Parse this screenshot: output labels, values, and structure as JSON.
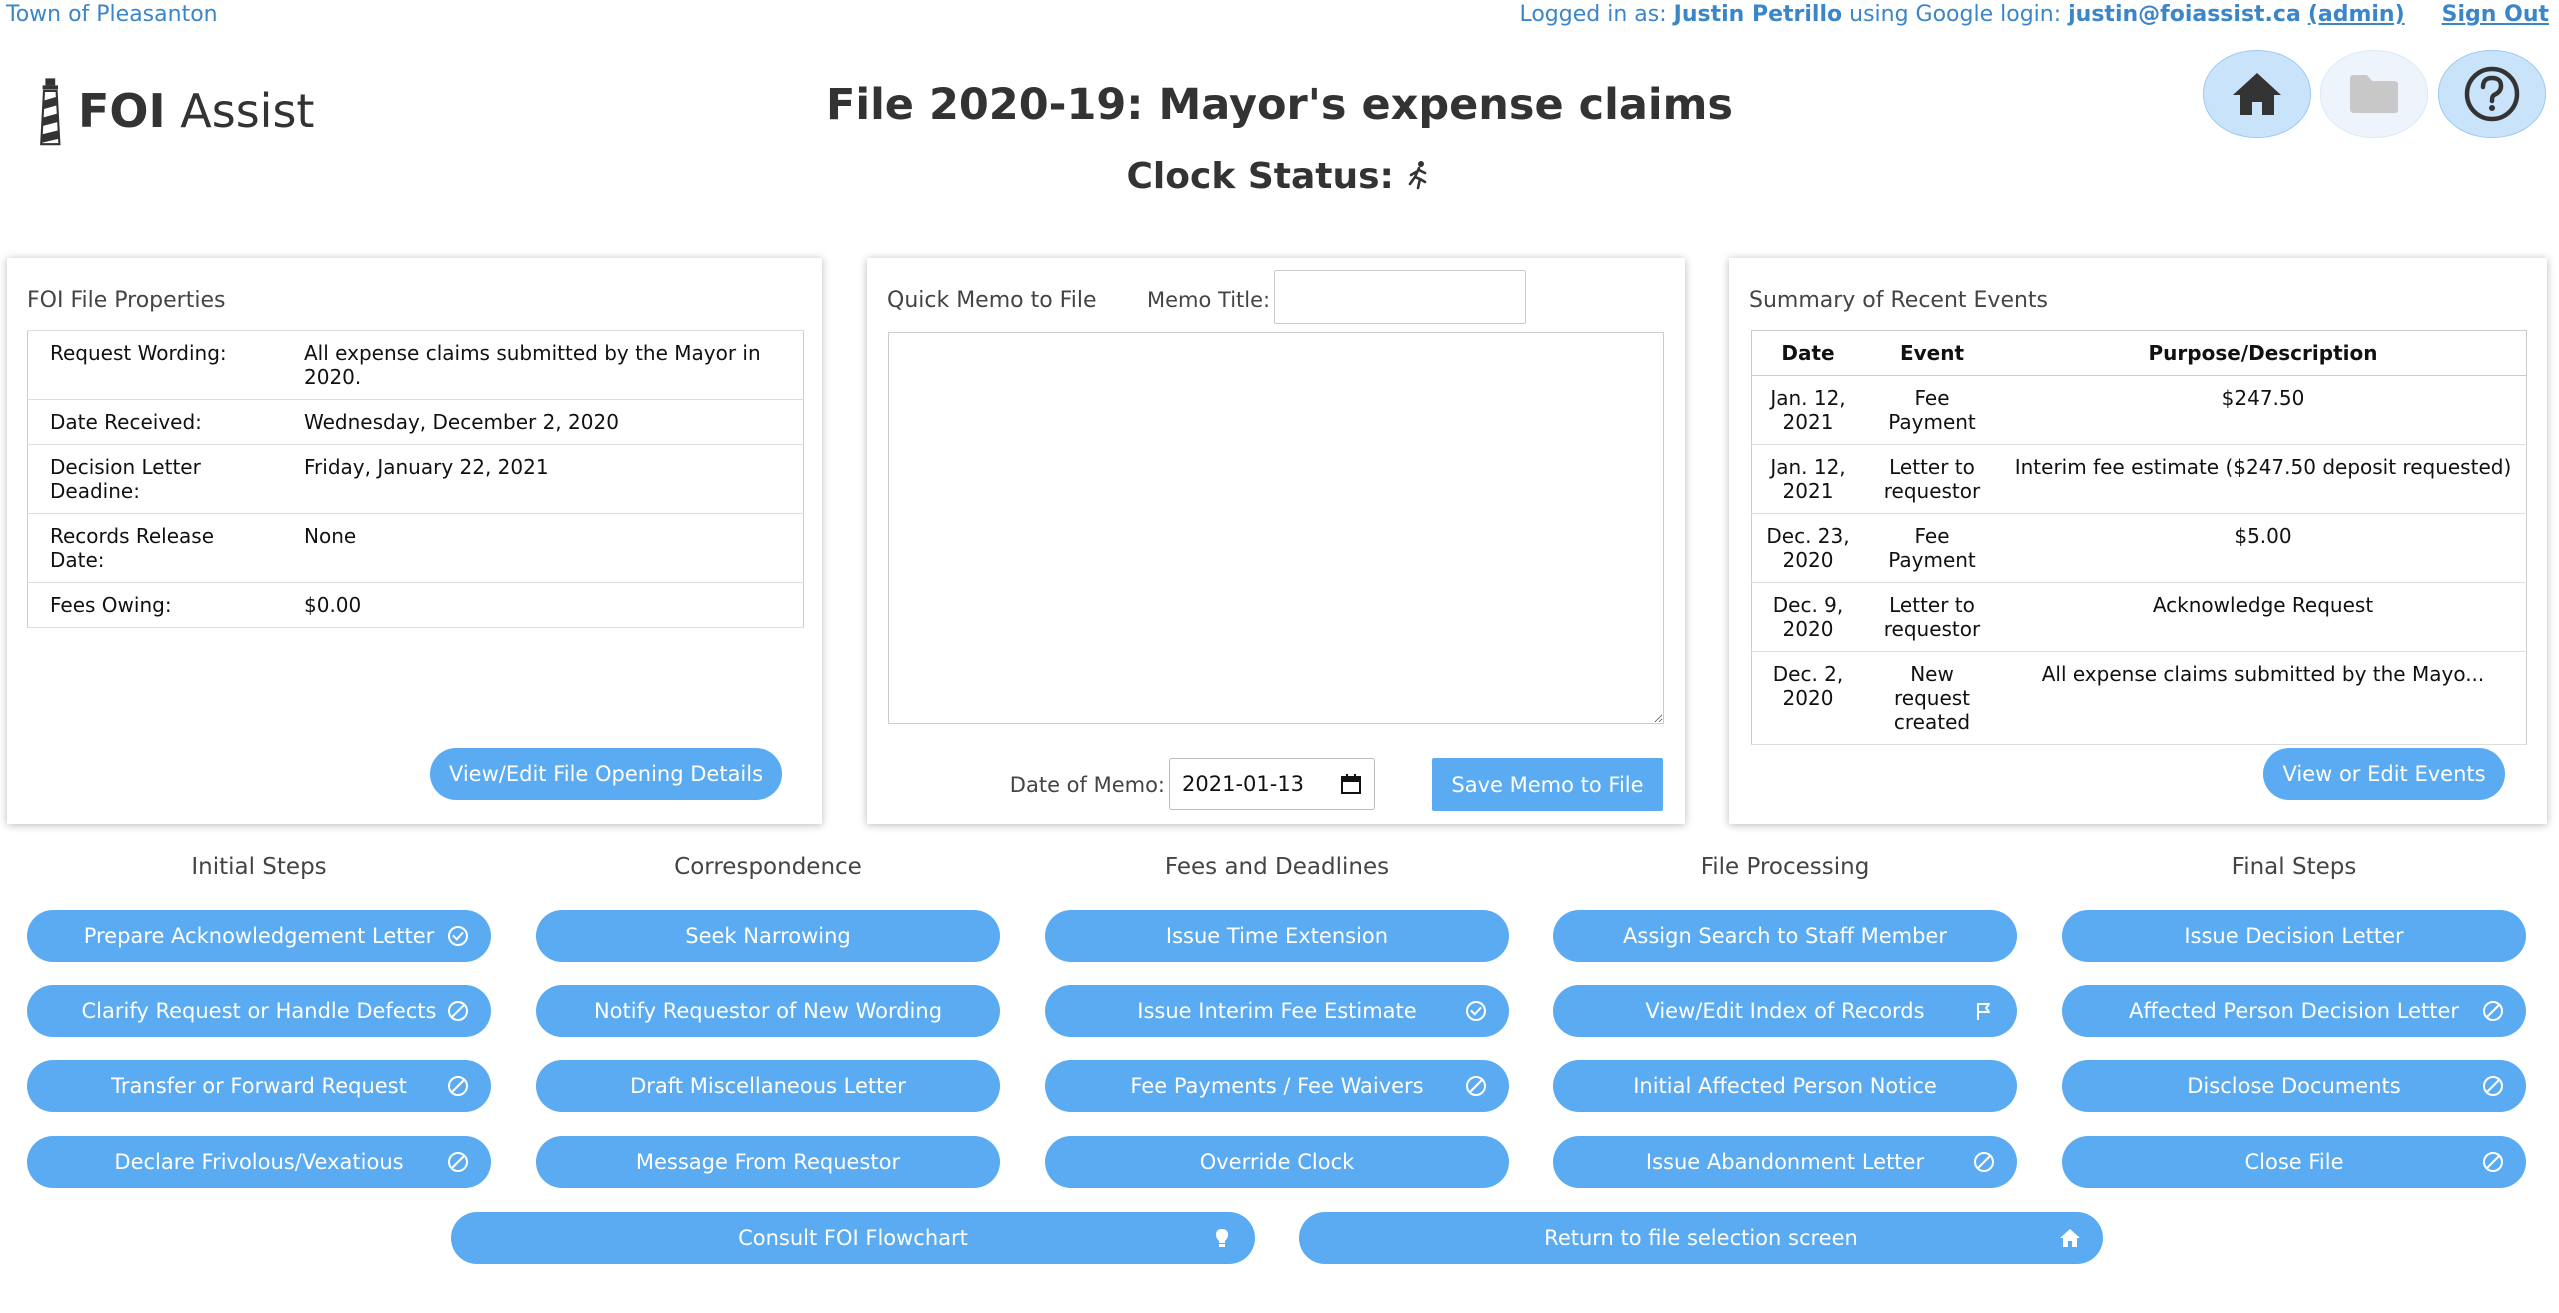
{
  "topbar": {
    "org_name": "Town of Pleasanton",
    "logged_in_prefix": "Logged in as:",
    "user_name": "Justin Petrillo",
    "login_method": "using Google login:",
    "email": "justin@foiassist.ca",
    "admin_link": "(admin)",
    "sign_out": "Sign Out"
  },
  "logo": {
    "bold": "FOI",
    "regular": "Assist"
  },
  "title": "File 2020-19: Mayor's expense claims",
  "clock_status_label": "Clock Status:",
  "clock_status_icon": "running-person-icon",
  "nav_buttons": [
    "home-icon",
    "folder-icon",
    "help-icon"
  ],
  "file_properties": {
    "title": "FOI File Properties",
    "rows": [
      {
        "label": "Request Wording:",
        "value": "All expense claims submitted by the Mayor in 2020."
      },
      {
        "label": "Date Received:",
        "value": "Wednesday, December 2, 2020"
      },
      {
        "label": "Decision Letter Deadine:",
        "value": "Friday, January 22, 2021"
      },
      {
        "label": "Records Release Date:",
        "value": "None"
      },
      {
        "label": "Fees Owing:",
        "value": "$0.00"
      }
    ],
    "button_label": "View/Edit File Opening Details"
  },
  "memo": {
    "title": "Quick Memo to File",
    "memo_title_label": "Memo Title:",
    "memo_title_value": "",
    "body_value": "",
    "date_label": "Date of Memo:",
    "date_value": "2021-01-13",
    "save_button": "Save Memo to File"
  },
  "events": {
    "title": "Summary of Recent Events",
    "columns": [
      "Date",
      "Event",
      "Purpose/Description"
    ],
    "rows": [
      [
        "Jan. 12, 2021",
        "Fee Payment",
        "$247.50"
      ],
      [
        "Jan. 12, 2021",
        "Letter to requestor",
        "Interim fee estimate ($247.50 deposit requested)"
      ],
      [
        "Dec. 23, 2020",
        "Fee Payment",
        "$5.00"
      ],
      [
        "Dec. 9, 2020",
        "Letter to requestor",
        "Acknowledge Request"
      ],
      [
        "Dec. 2, 2020",
        "New request created",
        "All expense claims submitted by the Mayo..."
      ]
    ],
    "button_label": "View or Edit Events"
  },
  "action_columns": [
    {
      "heading": "Initial Steps",
      "buttons": [
        {
          "label": "Prepare Acknowledgement Letter",
          "icon": "check-circle-icon"
        },
        {
          "label": "Clarify Request or Handle Defects",
          "icon": "block-icon"
        },
        {
          "label": "Transfer or Forward Request",
          "icon": "block-icon"
        },
        {
          "label": "Declare Frivolous/Vexatious",
          "icon": "block-icon"
        }
      ]
    },
    {
      "heading": "Correspondence",
      "buttons": [
        {
          "label": "Seek Narrowing",
          "icon": ""
        },
        {
          "label": "Notify Requestor of New Wording",
          "icon": ""
        },
        {
          "label": "Draft Miscellaneous Letter",
          "icon": ""
        },
        {
          "label": "Message From Requestor",
          "icon": ""
        }
      ]
    },
    {
      "heading": "Fees and Deadlines",
      "buttons": [
        {
          "label": "Issue Time Extension",
          "icon": ""
        },
        {
          "label": "Issue Interim Fee Estimate",
          "icon": "check-circle-icon"
        },
        {
          "label": "Fee Payments / Fee Waivers",
          "icon": "block-icon"
        },
        {
          "label": "Override Clock",
          "icon": ""
        }
      ]
    },
    {
      "heading": "File Processing",
      "buttons": [
        {
          "label": "Assign Search to Staff Member",
          "icon": ""
        },
        {
          "label": "View/Edit Index of Records",
          "icon": "flag-icon"
        },
        {
          "label": "Initial Affected Person Notice",
          "icon": ""
        },
        {
          "label": "Issue Abandonment Letter",
          "icon": "block-icon"
        }
      ]
    },
    {
      "heading": "Final Steps",
      "buttons": [
        {
          "label": "Issue Decision Letter",
          "icon": ""
        },
        {
          "label": "Affected Person Decision Letter",
          "icon": "block-icon"
        },
        {
          "label": "Disclose Documents",
          "icon": "block-icon"
        },
        {
          "label": "Close File",
          "icon": "block-icon"
        }
      ]
    }
  ],
  "bottom_buttons": [
    {
      "label": "Consult FOI Flowchart",
      "icon": "lightbulb-icon"
    },
    {
      "label": "Return to file selection screen",
      "icon": "home-icon"
    }
  ],
  "colors": {
    "button_blue": "#5aabf2",
    "link_blue": "#3a86c8",
    "nav_circle": "#c9e3fb"
  }
}
